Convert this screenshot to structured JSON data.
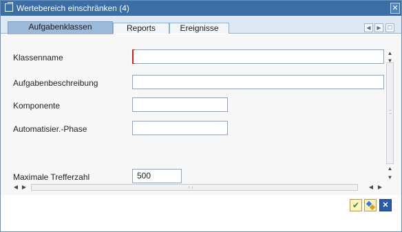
{
  "window": {
    "title": "Wertebereich einschränken (4)",
    "title_icon": "external-window-icon",
    "close_glyph": "✕"
  },
  "tabs": [
    {
      "label": "Aufgabenklassen",
      "active": true
    },
    {
      "label": "Reports",
      "active": false
    },
    {
      "label": "Ereignisse",
      "active": false
    }
  ],
  "tab_nav": {
    "prev_glyph": "◀",
    "next_glyph": "▶",
    "list_glyph": "☐"
  },
  "form": {
    "fields": [
      {
        "label": "Klassenname",
        "value": ""
      },
      {
        "label": "Aufgabenbeschreibung",
        "value": ""
      },
      {
        "label": "Komponente",
        "value": ""
      },
      {
        "label": "Automatisier.-Phase",
        "value": ""
      },
      {
        "label": "Maximale Trefferzahl",
        "value": "500"
      }
    ]
  },
  "scrollbars": {
    "up_glyph": "▲",
    "down_glyph": "▼",
    "left_glyph": "◀",
    "right_glyph": "▶"
  },
  "footer": {
    "ok_glyph": "✔",
    "cancel_glyph": "✕"
  },
  "colors": {
    "title_bar": "#3a6ea5",
    "active_tab": "#9cb9d9",
    "focus_marker": "#cc2222",
    "ok_check": "#2d8a1e",
    "cancel_button": "#2b5aa6"
  }
}
